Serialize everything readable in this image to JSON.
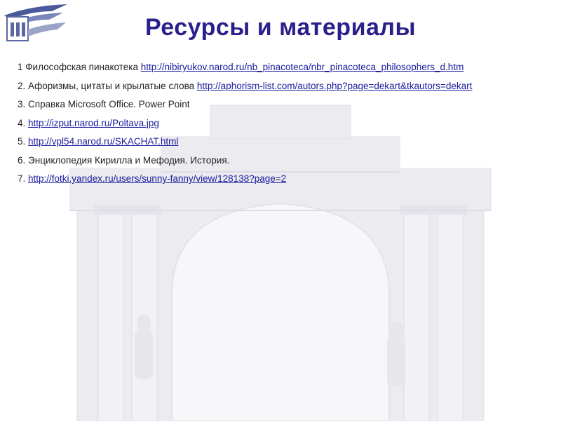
{
  "slide": {
    "title": "Ресурсы и материалы",
    "logo_icon": "arch-building-logo-icon",
    "background_icon": "triumphal-arch-icon",
    "colors": {
      "title": "#2b1f8c",
      "link": "#1a1a9e",
      "text": "#222222",
      "background_art": "#e6e6ec"
    }
  },
  "references": [
    {
      "number": "1",
      "text": "Философская пинакотека",
      "url": "http://nibiryukov.narod.ru/nb_pinacoteca/nbr_pinacoteca_philosophers_d.htm"
    },
    {
      "number": "2.",
      "text": "Афоризмы, цитаты и крылатые слова",
      "url": "http://aphorism-list.com/autors.php?page=dekart&tkautors=dekart"
    },
    {
      "number": "3.",
      "text": "Справка Microsoft Office. Power Point",
      "url": ""
    },
    {
      "number": "4.",
      "text": "",
      "url": "http://izput.narod.ru/Poltava.jpg"
    },
    {
      "number": "5.",
      "text": "",
      "url": "http://vpl54.narod.ru/SKACHAT.html"
    },
    {
      "number": "6.",
      "text": "Энциклопедия Кирилла и Мефодия. История.",
      "url": ""
    },
    {
      "number": "7.",
      "text": "",
      "url": "http://fotki.yandex.ru/users/sunny-fanny/view/128138?page=2"
    }
  ]
}
